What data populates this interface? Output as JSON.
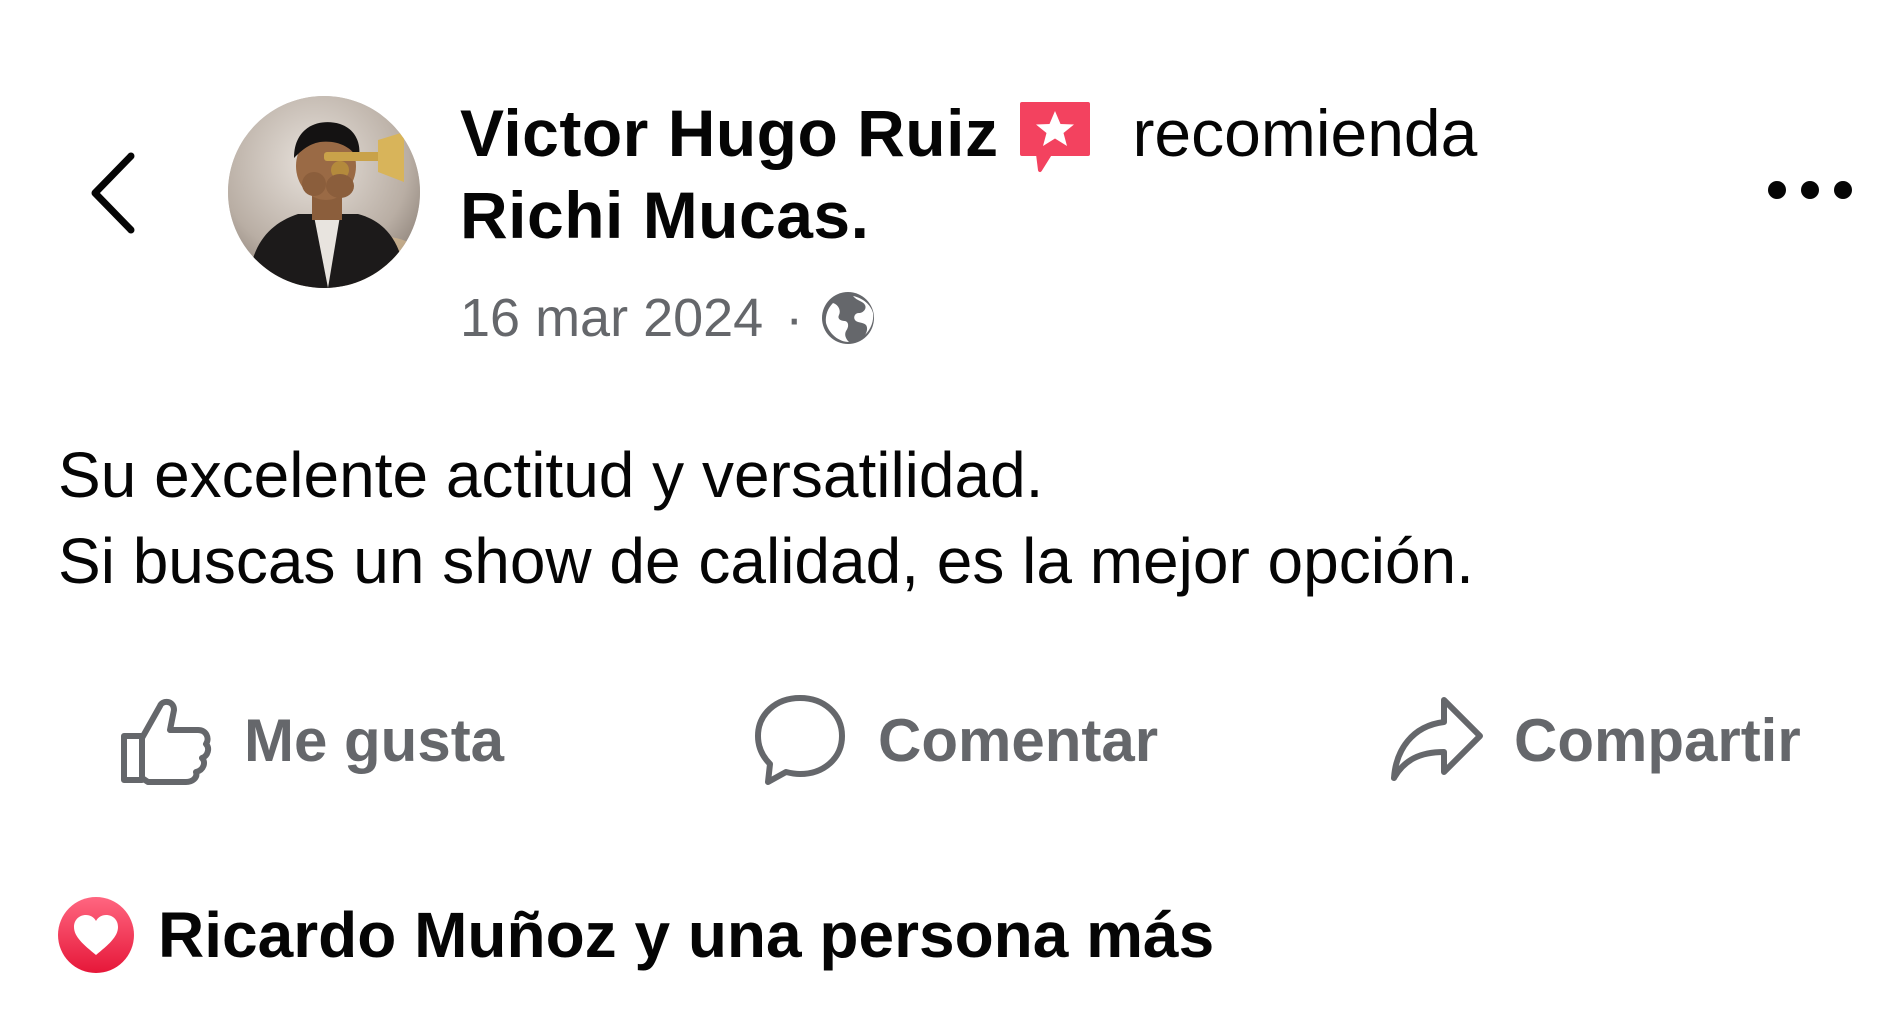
{
  "post": {
    "author_name": "Victor Hugo Ruiz",
    "action_text": "recomienda",
    "page_name": "Richi Mucas.",
    "date": "16 mar 2024",
    "separator": "·",
    "body_lines": [
      "Su excelente actitud y versatilidad.",
      "Si buscas un show de calidad, es la mejor opción."
    ]
  },
  "actions": {
    "like_label": "Me gusta",
    "comment_label": "Comentar",
    "share_label": "Compartir"
  },
  "reactions": {
    "summary": "Ricardo Muñoz y una persona más"
  },
  "icons": {
    "back": "chevron-left-icon",
    "recommend": "recommend-star-badge-icon",
    "privacy": "globe-icon",
    "more": "more-dots-icon",
    "like": "thumbs-up-icon",
    "comment": "comment-bubble-icon",
    "share": "share-arrow-icon",
    "reaction": "love-reaction-icon"
  },
  "colors": {
    "text_primary": "#050505",
    "text_secondary": "#65676b",
    "recommend_badge": "#f3425f",
    "love_reaction": "#f33e58"
  }
}
